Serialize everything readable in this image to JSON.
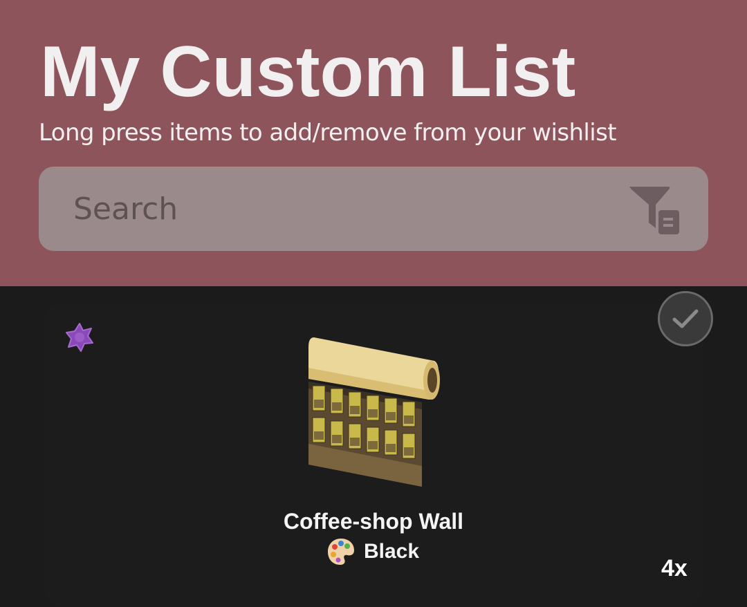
{
  "header": {
    "title": "My Custom List",
    "subtitle": "Long press items to add/remove from your wishlist",
    "background_color": "#8d555b"
  },
  "search": {
    "placeholder": "Search",
    "value": "",
    "filter_icon": "filter-list-icon"
  },
  "items": [
    {
      "name": "Coffee-shop Wall",
      "variant": "Black",
      "quantity": "4x",
      "badge_icon": "purple-star-badge-icon",
      "variant_icon": "palette-icon",
      "collected_icon": "checkmark-icon",
      "image": "coffee-shop-wall-roll"
    }
  ]
}
